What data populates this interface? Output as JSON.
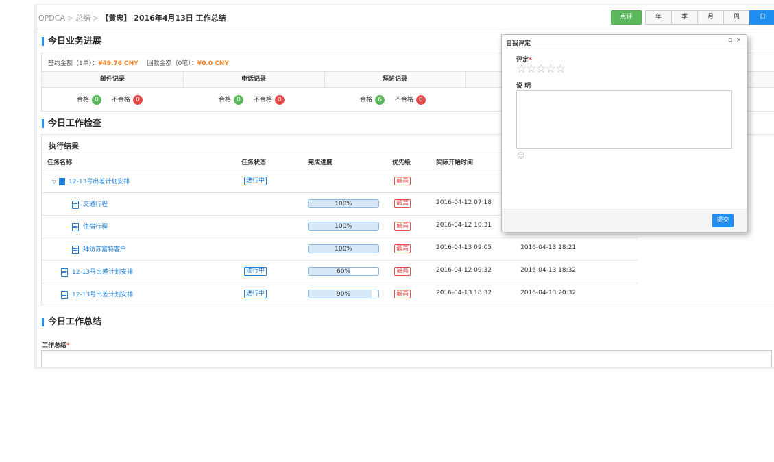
{
  "breadcrumb": {
    "root": "OPDCA",
    "sep": ">",
    "section": "总结",
    "sep2": ">",
    "title": "【黄忠】 2016年4月13日 工作总结"
  },
  "actions": {
    "review_label": "点评",
    "periods": [
      "年",
      "季",
      "月",
      "周",
      "日"
    ],
    "active_period": "日"
  },
  "business": {
    "title": "今日业务进展",
    "signed_label": "签约金额（1单）：",
    "signed_value": "¥49.76 CNY",
    "return_label": "回款金额（0笔）：",
    "return_value": "¥0.0 CNY",
    "columns": [
      "邮件记录",
      "电话记录",
      "拜访记录"
    ],
    "stats": [
      {
        "pass_label": "合格",
        "pass": "0",
        "fail_label": "不合格",
        "fail": "0"
      },
      {
        "pass_label": "合格",
        "pass": "0",
        "fail_label": "不合格",
        "fail": "0"
      },
      {
        "pass_label": "合格",
        "pass": "6",
        "fail_label": "不合格",
        "fail": "0"
      }
    ]
  },
  "check": {
    "title": "今日工作检查",
    "subtitle": "执行结果",
    "headers": [
      "任务名称",
      "任务状态",
      "完成进度",
      "优先级",
      "实际开始时间"
    ],
    "rows": [
      {
        "name": "12-13号出差计划安排",
        "status": "进行中",
        "progress": "",
        "priority": "最高",
        "start": "",
        "end": ""
      },
      {
        "name": "交通行程",
        "status": "",
        "progress": "100%",
        "priority": "最高",
        "start": "2016-04-12 07:18",
        "end": ""
      },
      {
        "name": "住宿行程",
        "status": "",
        "progress": "100%",
        "priority": "最高",
        "start": "2016-04-12 10:31",
        "end": ""
      },
      {
        "name": "拜访苏富特客户",
        "status": "",
        "progress": "100%",
        "priority": "最高",
        "start": "2016-04-13 09:05",
        "end": "2016-04-13 18:21"
      },
      {
        "name": "12-13号出差计划安排",
        "status": "进行中",
        "progress": "60%",
        "priority": "最高",
        "start": "2016-04-12 09:32",
        "end": "2016-04-13 18:32"
      },
      {
        "name": "12-13号出差计划安排",
        "status": "进行中",
        "progress": "90%",
        "priority": "最高",
        "start": "2016-04-13 18:32",
        "end": "2016-04-13 20:32"
      }
    ]
  },
  "summary": {
    "title": "今日工作总结",
    "label": "工作总结",
    "required": "*"
  },
  "dialog": {
    "title": "自我评定",
    "rating_label": "评定",
    "required": "*",
    "stars": [
      "☆",
      "☆",
      "☆",
      "☆",
      "☆"
    ],
    "desc_label": "说 明",
    "submit_label": "提交",
    "maximize": "▫",
    "close": "×",
    "emoji": "☺"
  }
}
